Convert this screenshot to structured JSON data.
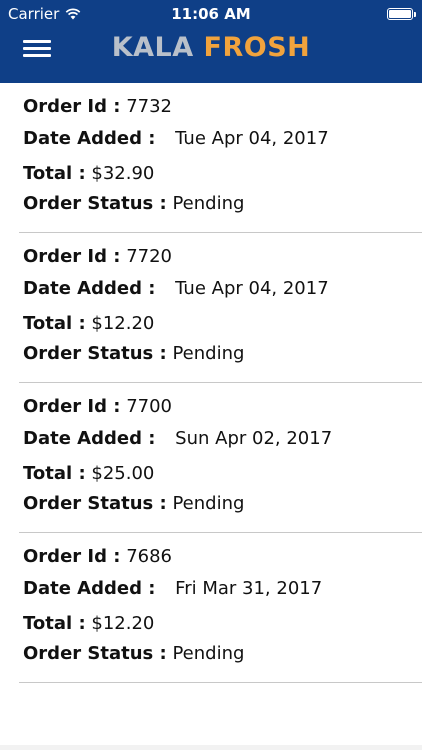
{
  "status_bar": {
    "carrier": "Carrier",
    "time": "11:06 AM"
  },
  "header": {
    "brand_part1": "KALA",
    "brand_part2": "FROSH",
    "background_color": "#0f3f87",
    "accent_color": "#f1a33d"
  },
  "labels": {
    "order_id": "Order Id :",
    "date_added": "Date Added :",
    "total": "Total :",
    "order_status": "Order Status :"
  },
  "orders": [
    {
      "id": "7732",
      "date": "Tue Apr 04, 2017",
      "total": "$32.90",
      "status": "Pending"
    },
    {
      "id": "7720",
      "date": "Tue Apr 04, 2017",
      "total": "$12.20",
      "status": "Pending"
    },
    {
      "id": "7700",
      "date": "Sun Apr 02, 2017",
      "total": "$25.00",
      "status": "Pending"
    },
    {
      "id": "7686",
      "date": "Fri Mar 31, 2017",
      "total": "$12.20",
      "status": "Pending"
    }
  ]
}
